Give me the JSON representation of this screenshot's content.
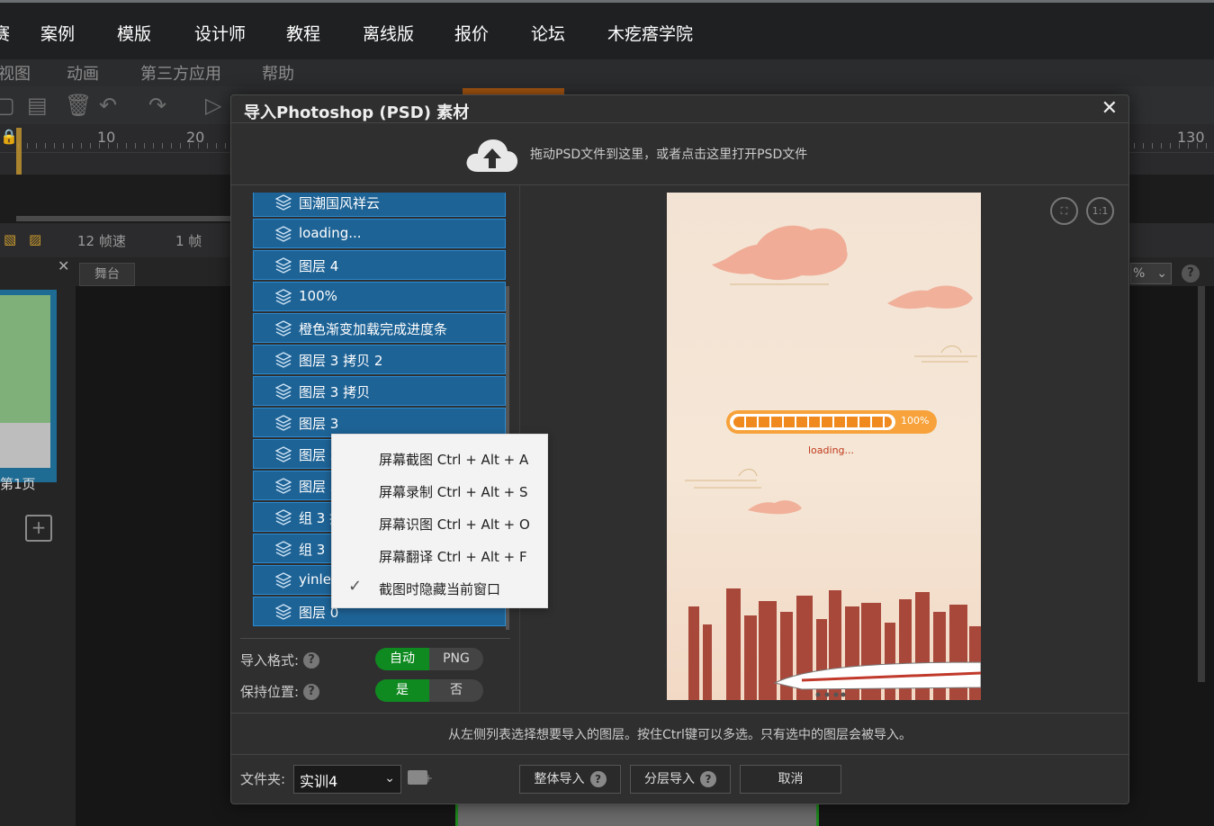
{
  "top_nav": [
    "赛",
    "案例",
    "模版",
    "设计师",
    "教程",
    "离线版",
    "报价",
    "论坛",
    "木疙瘩学院"
  ],
  "sub_nav": [
    "视图",
    "动画",
    "第三方应用",
    "帮助"
  ],
  "ruler": {
    "labels": [
      "10",
      "20",
      "130"
    ]
  },
  "frames_bar": {
    "fps": "12 帧速",
    "frame": "1 帧"
  },
  "left_panel": {
    "page_label": "第1页"
  },
  "stage_tab": "舞台",
  "zoom": {
    "value": "%",
    "caret": "⌄"
  },
  "dialog": {
    "title": "导入Photoshop (PSD) 素材",
    "close": "✕",
    "upload_text": "拖动PSD文件到这里，或者点击这里打开PSD文件",
    "layers": [
      "国潮国风祥云",
      "loading...",
      "图层 4",
      "100%",
      "橙色渐变加载完成进度条",
      "图层 3 拷贝 2",
      "图层 3 拷贝",
      "图层 3",
      "图层 2",
      "图层 5 拷贝 4",
      "组 3 拷贝",
      "组 3",
      "yinle",
      "图层 0"
    ],
    "import_format": {
      "label": "导入格式:",
      "on": "自动",
      "off": "PNG",
      "help": "?"
    },
    "keep_position": {
      "label": "保持位置:",
      "on": "是",
      "off": "否",
      "help": "?"
    },
    "preview": {
      "fit_btn": "⛶",
      "one_to_one_btn": "1:1",
      "progress_pct": "100%",
      "progress_value": 1.0,
      "loading_text": "loading..."
    },
    "hint": "从左侧列表选择想要导入的图层。按住Ctrl键可以多选。只有选中的图层会被导入。",
    "folder": {
      "label": "文件夹:",
      "value": "实训4"
    },
    "buttons": {
      "import_all": "整体导入",
      "import_layers": "分层导入",
      "cancel": "取消",
      "help": "?"
    }
  },
  "context_menu": [
    {
      "label": "屏幕截图 Ctrl + Alt + A",
      "checked": false
    },
    {
      "label": "屏幕录制 Ctrl + Alt + S",
      "checked": false
    },
    {
      "label": "屏幕识图 Ctrl + Alt + O",
      "checked": false
    },
    {
      "label": "屏幕翻译 Ctrl + Alt + F",
      "checked": false
    },
    {
      "label": "截图时隐藏当前窗口",
      "checked": true
    }
  ],
  "colors": {
    "layer_bg": "#1e6396",
    "accent_green": "#0f8a20",
    "progress_orange": "#f7a23a"
  }
}
